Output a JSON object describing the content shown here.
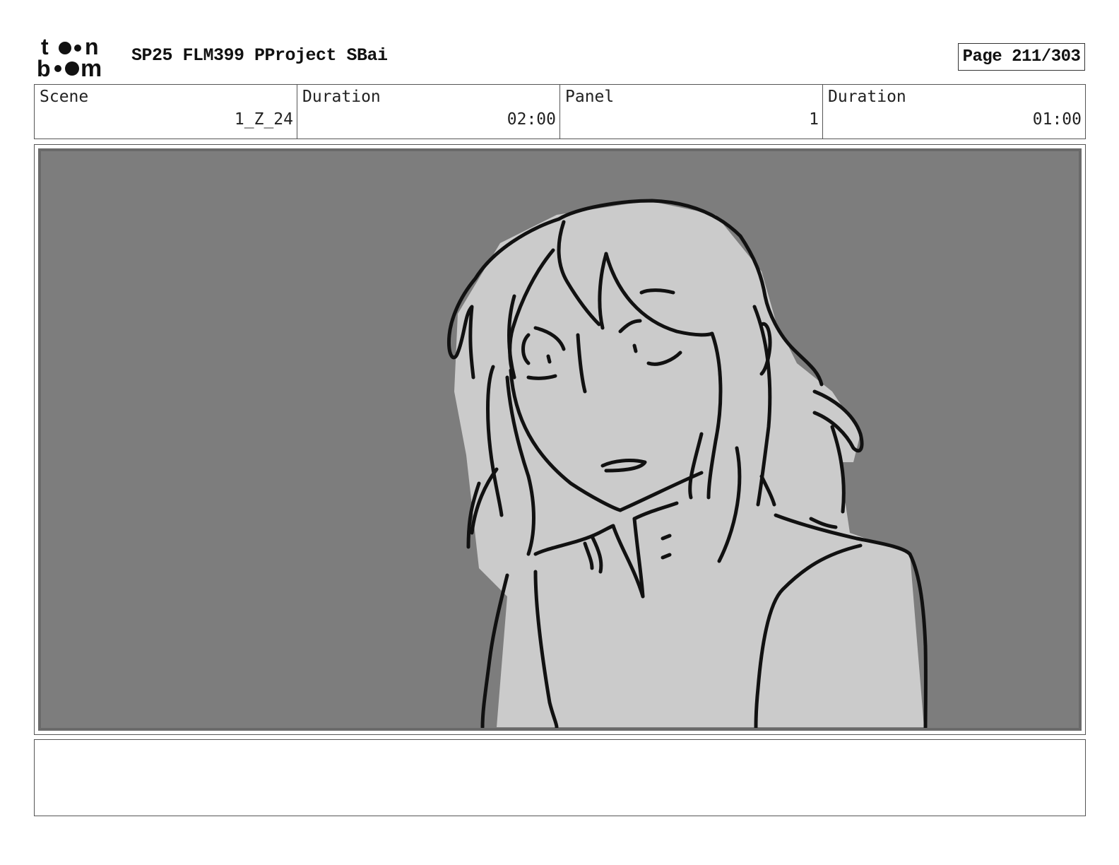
{
  "header": {
    "logo_top": "t",
    "logo_top_end": "n",
    "logo_bottom_start": "b",
    "logo_bottom_end": "m",
    "project_title": "SP25 FLM399 PProject SBai",
    "page_label": "Page 211/303"
  },
  "info": [
    {
      "label": "Scene",
      "value": "1_Z_24"
    },
    {
      "label": "Duration",
      "value": "02:00"
    },
    {
      "label": "Panel",
      "value": "1"
    },
    {
      "label": "Duration",
      "value": "01:00"
    }
  ],
  "panel": {
    "background_color": "#7d7d7d",
    "figure_fill": "#cbcbcb",
    "line_color": "#111111"
  },
  "notes": {
    "text": ""
  }
}
